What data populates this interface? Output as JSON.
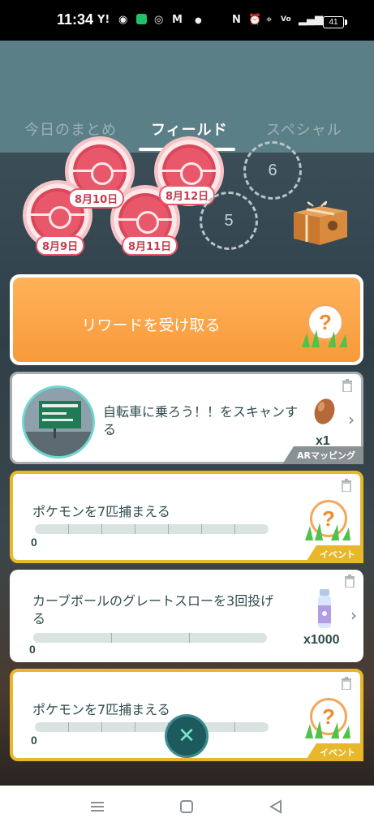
{
  "status_bar": {
    "time": "11:34",
    "battery": "41",
    "icons": [
      "yahoo-icon",
      "eye-icon",
      "line-icon",
      "chat-icon",
      "gmail-icon",
      "dot-icon",
      "nfc-icon",
      "alarm-icon",
      "location-icon",
      "volte-icon",
      "signal-4g-icon",
      "battery-icon"
    ]
  },
  "tabs": [
    {
      "label": "今日のまとめ",
      "active": false
    },
    {
      "label": "フィールド",
      "active": true
    },
    {
      "label": "スペシャル",
      "active": false
    }
  ],
  "stamps": [
    {
      "date": "8月9日"
    },
    {
      "date": "8月10日"
    },
    {
      "date": "8月11日"
    },
    {
      "date": "8月12日"
    }
  ],
  "upcoming": [
    "5",
    "6"
  ],
  "reward_button": {
    "label": "リワードを受け取る",
    "icon": "mystery-reward-icon"
  },
  "tasks": [
    {
      "title": "自転車に乗ろう！！をスキャンする",
      "reward_icon": "pinap-berry-icon",
      "reward_amount": "x1",
      "tag": "ARマッピング",
      "has_chevron": true
    },
    {
      "title": "ポケモンを7匹捕まえる",
      "progress_label": "0",
      "progress": 0,
      "reward_icon": "mystery-reward-icon",
      "tag": "イベント"
    },
    {
      "title": "カーブボールのグレートスローを3回投げる",
      "progress_label": "0",
      "progress": 0,
      "reward_icon": "stardust-icon",
      "reward_amount": "x1000",
      "has_chevron": true
    },
    {
      "title": "ポケモンを7匹捕まえる",
      "progress_label": "0",
      "progress": 0,
      "reward_icon": "mystery-reward-icon",
      "tag": "イベント"
    }
  ],
  "close_icon": "close-icon",
  "nav": [
    "menu-icon",
    "home-icon",
    "back-icon"
  ],
  "colors": {
    "accent_orange": "#f89a3a",
    "event_gold": "#e8b82a",
    "header_teal": "#5b7f86",
    "stamp_red": "#e9586a"
  }
}
